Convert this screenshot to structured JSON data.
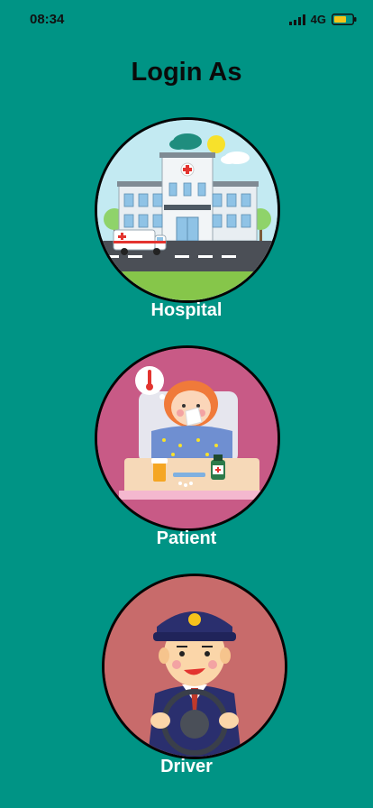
{
  "status_bar": {
    "time": "08:34",
    "network": "4G",
    "signal_icon": "signal-bars-icon",
    "battery_icon": "battery-icon",
    "battery_color": "#f5c518"
  },
  "page": {
    "title": "Login As"
  },
  "options": [
    {
      "label": "Hospital",
      "illustration": "hospital-illustration",
      "background": "#b9e6f0"
    },
    {
      "label": "Patient",
      "illustration": "patient-illustration",
      "background": "#c85a86"
    },
    {
      "label": "Driver",
      "illustration": "driver-illustration",
      "background": "#c86b6b"
    }
  ],
  "colors": {
    "background": "#009485",
    "title": "#0a0a0a",
    "label": "#ffffff"
  }
}
